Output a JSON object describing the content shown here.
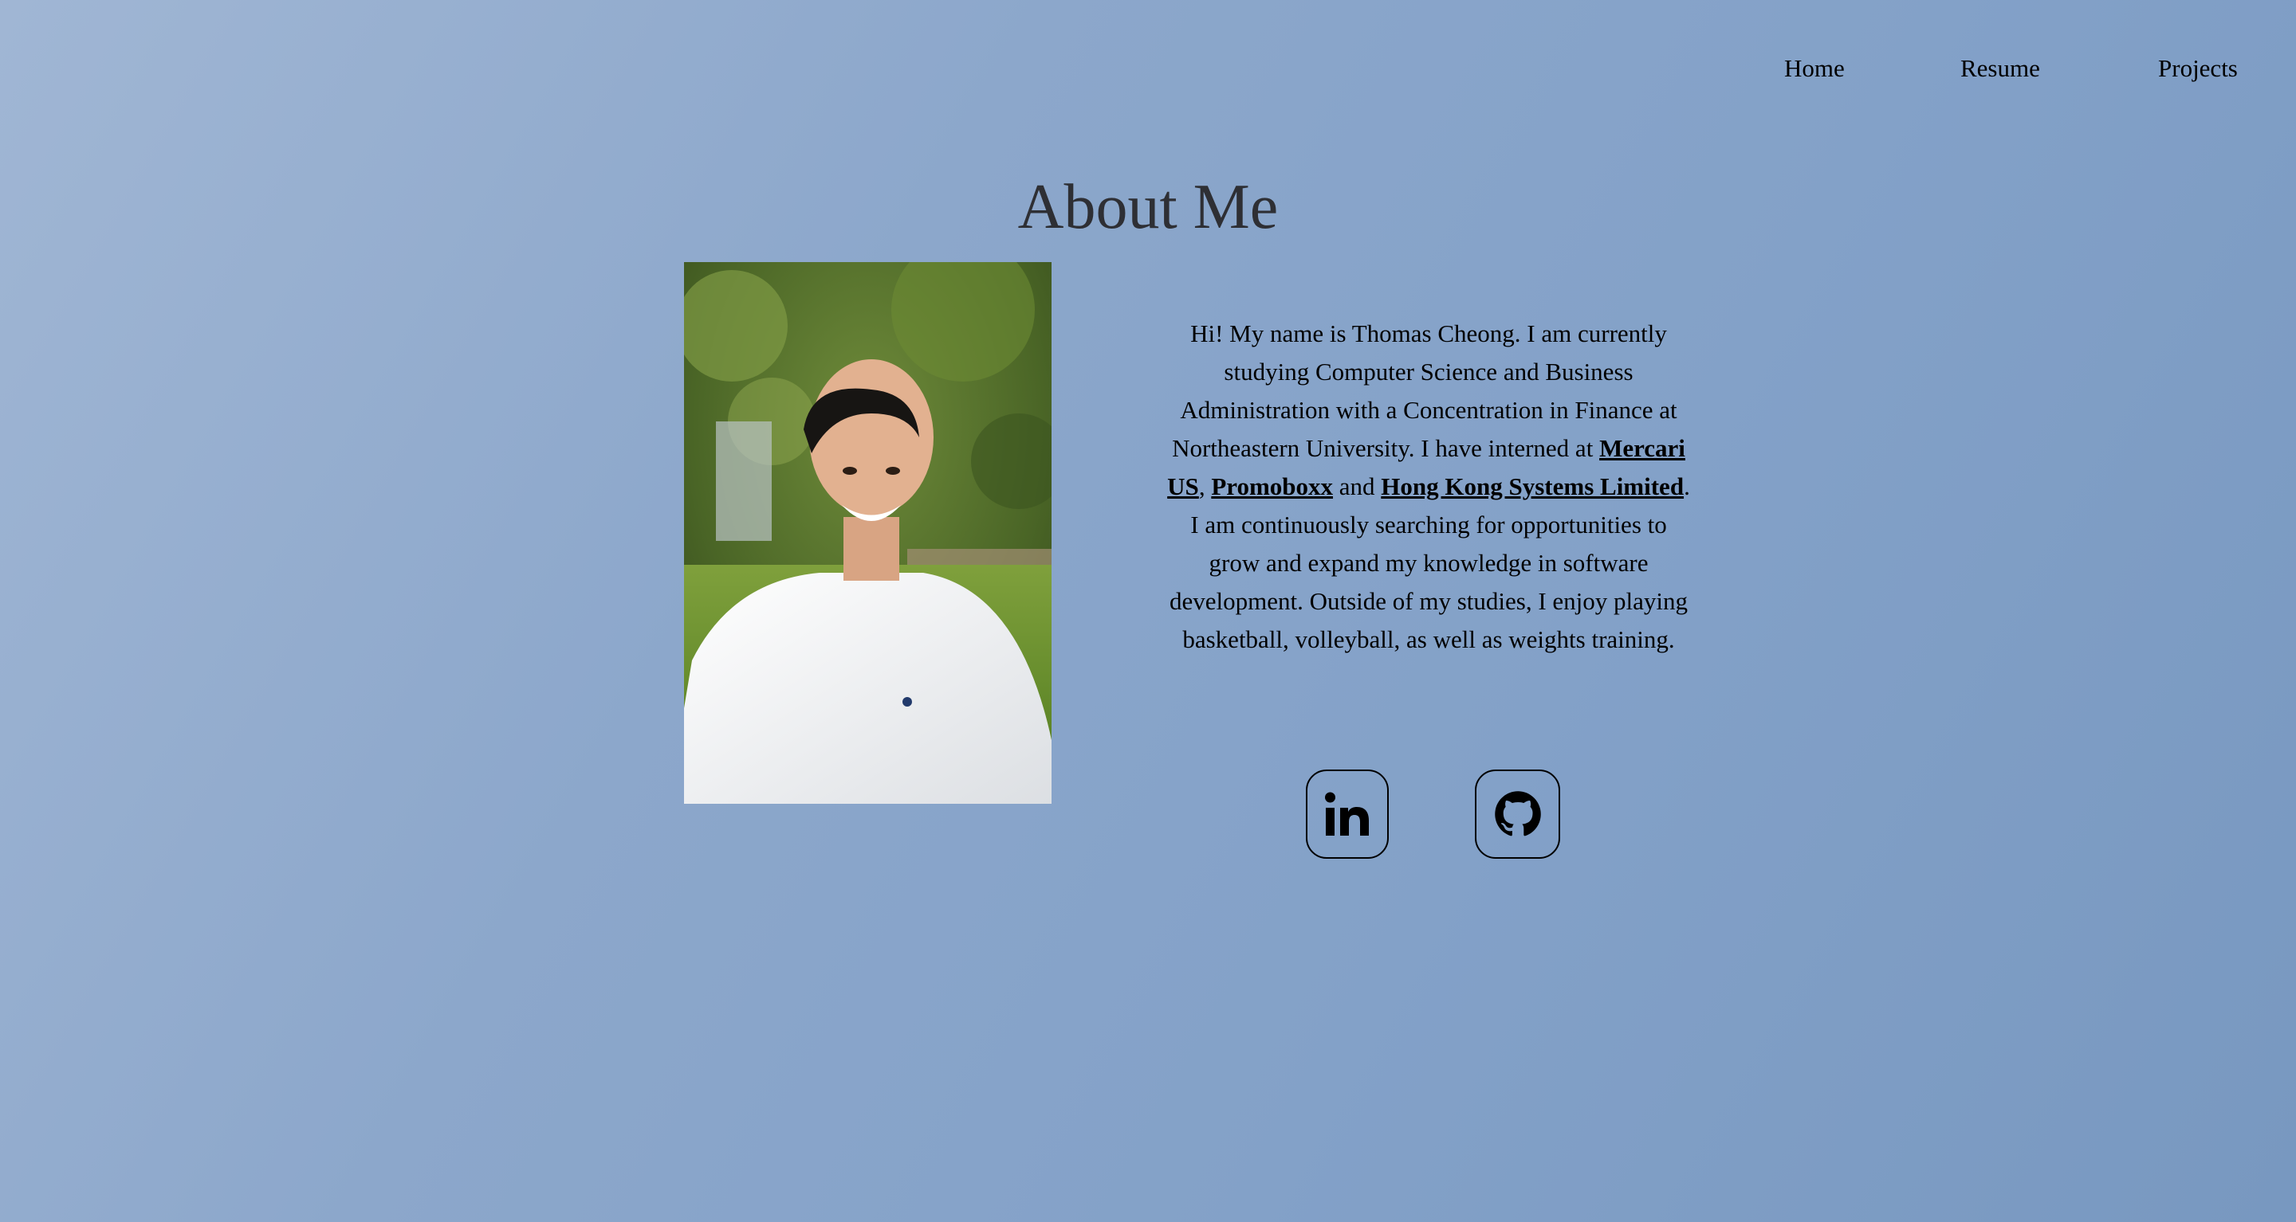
{
  "nav": {
    "home": "Home",
    "resume": "Resume",
    "projects": "Projects"
  },
  "about": {
    "title": "About Me",
    "bio": {
      "part1": "Hi! My name is Thomas Cheong. I am currently studying Computer Science and Business Administration with a Concentration in Finance at Northeastern University. I have interned at ",
      "link1": "Mercari US",
      "sep1": ", ",
      "link2": "Promoboxx",
      "sep2": " and ",
      "link3": "Hong Kong Systems Limited",
      "part2": ". I am continuously searching for opportunities to grow and expand my knowledge in software development. Outside of my studies, I enjoy playing basketball, volleyball, as well as weights training."
    }
  },
  "social": {
    "linkedin_icon": "linkedin-icon",
    "github_icon": "github-icon"
  }
}
